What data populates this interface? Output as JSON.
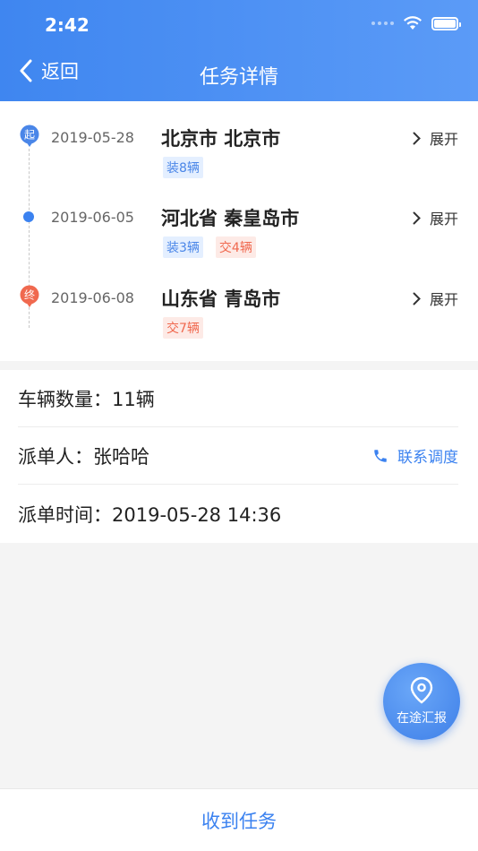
{
  "status_bar": {
    "time": "2:42"
  },
  "nav": {
    "back_label": "返回",
    "title": "任务详情"
  },
  "route": {
    "stops": [
      {
        "marker_text": "起",
        "date": "2019-05-28",
        "city": "北京市 北京市",
        "expand_label": "展开",
        "tags": [
          {
            "type": "load",
            "text": "装8辆"
          }
        ]
      },
      {
        "marker_text": "",
        "date": "2019-06-05",
        "city": "河北省 秦皇岛市",
        "expand_label": "展开",
        "tags": [
          {
            "type": "load",
            "text": "装3辆"
          },
          {
            "type": "unload",
            "text": "交4辆"
          }
        ]
      },
      {
        "marker_text": "终",
        "date": "2019-06-08",
        "city": "山东省 青岛市",
        "expand_label": "展开",
        "tags": [
          {
            "type": "unload",
            "text": "交7辆"
          }
        ]
      }
    ]
  },
  "info": {
    "vehicle_count": "车辆数量：11辆",
    "dispatcher": "派单人：张哈哈",
    "contact_label": "联系调度",
    "dispatch_time": "派单时间：2019-05-28 14:36"
  },
  "fab": {
    "label": "在途汇报"
  },
  "bottom": {
    "action_label": "收到任务"
  },
  "colors": {
    "primary": "#3b82f0",
    "start_marker": "#4a86e8",
    "end_marker": "#f0694f"
  }
}
